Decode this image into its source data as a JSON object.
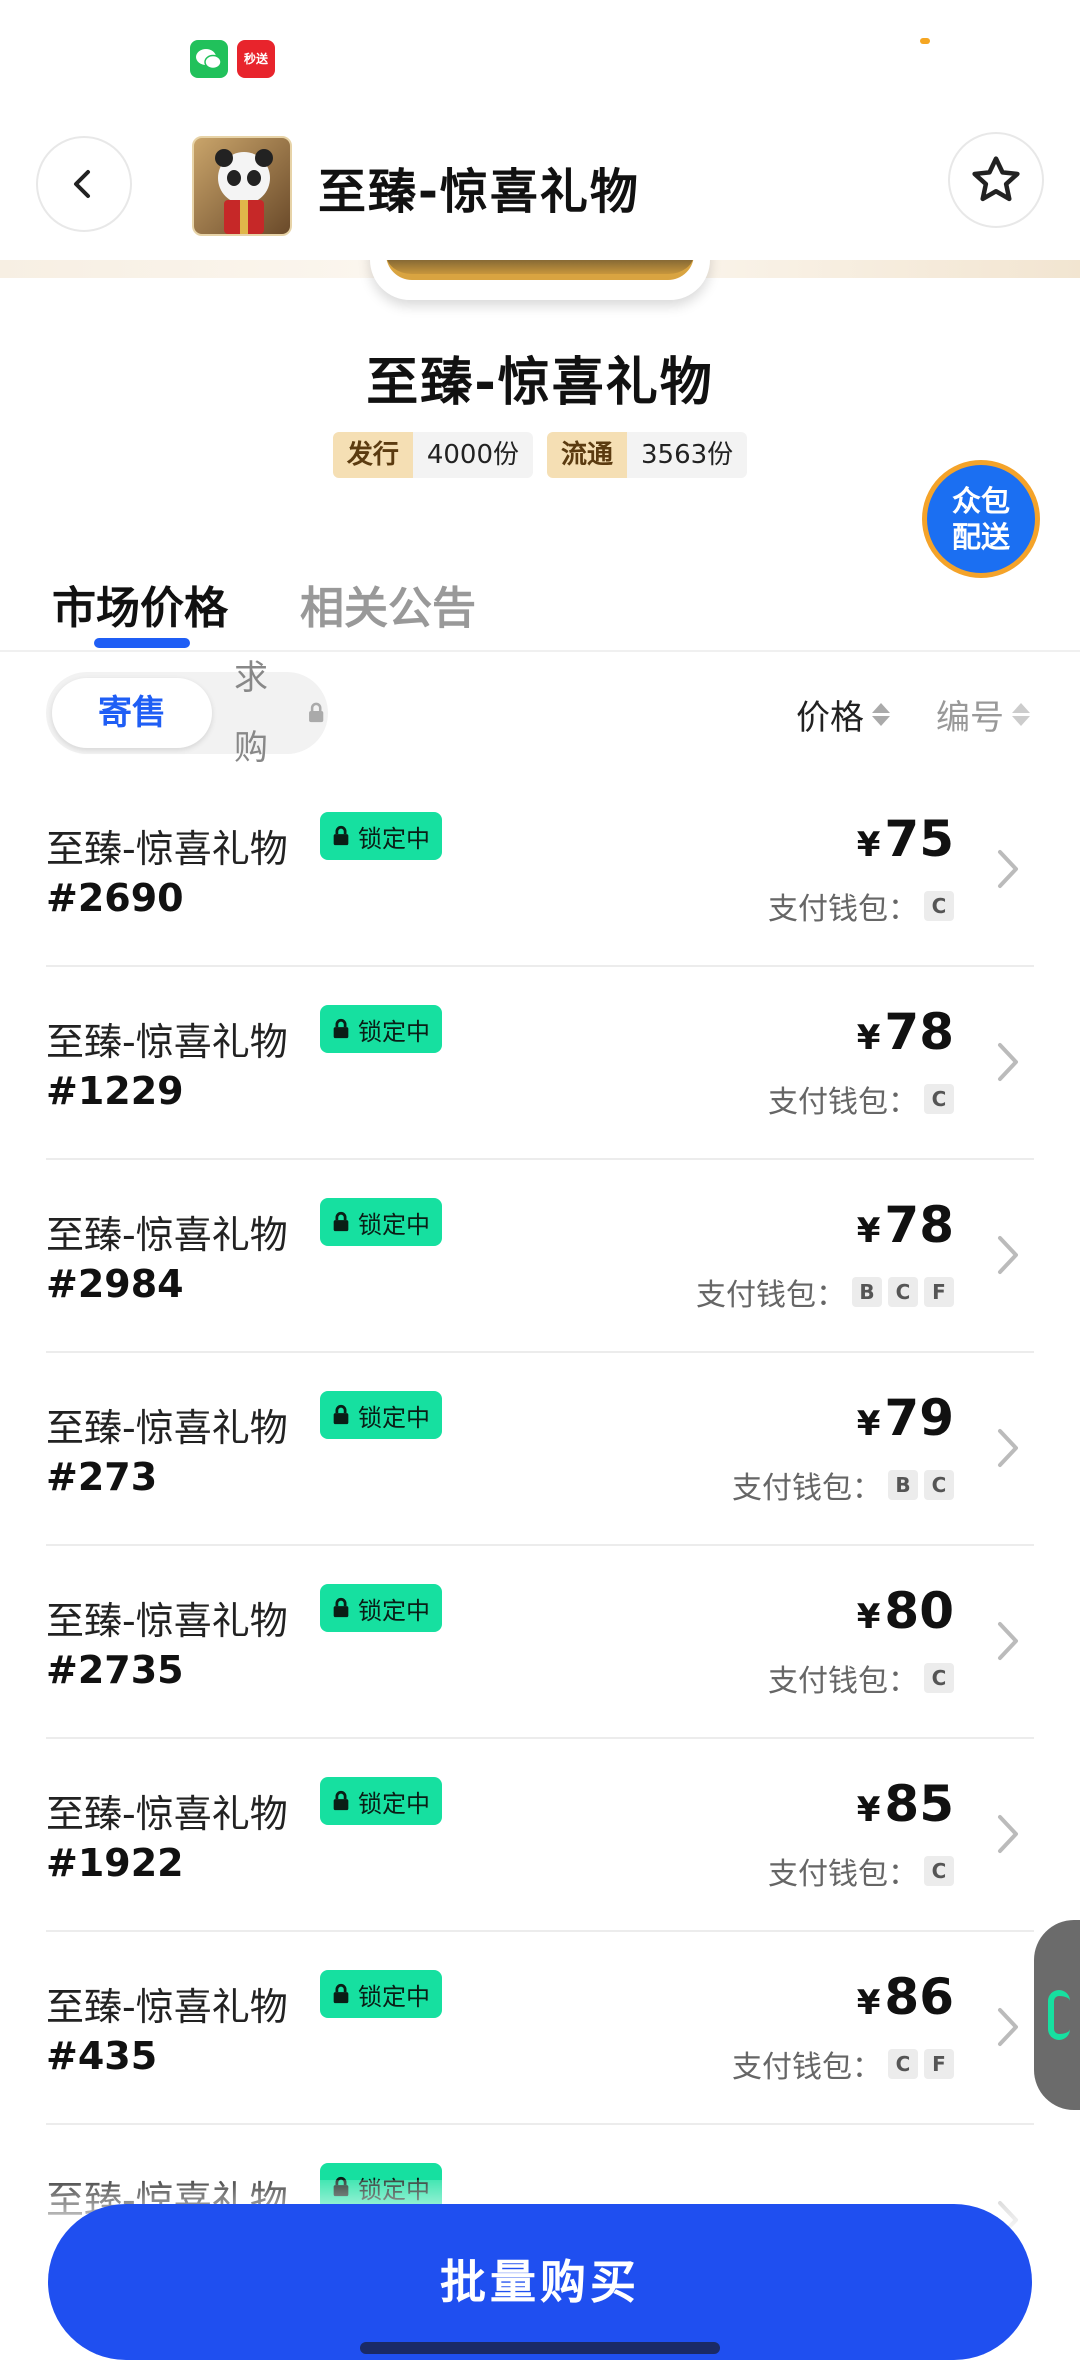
{
  "status_bar": {
    "wechat_icon": "wechat-icon",
    "miaosong_label": "秒送"
  },
  "header": {
    "title": "至臻-惊喜礼物",
    "back_icon": "chevron-left-icon",
    "favorite_icon": "star-outline-icon"
  },
  "item": {
    "title": "至臻-惊喜礼物",
    "issue_label": "发行",
    "issue_value": "4000份",
    "circulation_label": "流通",
    "circulation_value": "3563份"
  },
  "floating_badge": {
    "line1": "众包",
    "line2": "配送"
  },
  "tabs": [
    {
      "label": "市场价格",
      "active": true
    },
    {
      "label": "相关公告",
      "active": false
    }
  ],
  "filters": {
    "consign_label": "寄售",
    "request_label": "求购",
    "sort_price": "价格",
    "sort_number": "编号"
  },
  "listings": [
    {
      "name": "至臻-惊喜礼物",
      "number": "#2690",
      "status": "锁定中",
      "price": "75",
      "wallet_label": "支付钱包：",
      "wallets": [
        "C"
      ]
    },
    {
      "name": "至臻-惊喜礼物",
      "number": "#1229",
      "status": "锁定中",
      "price": "78",
      "wallet_label": "支付钱包：",
      "wallets": [
        "C"
      ]
    },
    {
      "name": "至臻-惊喜礼物",
      "number": "#2984",
      "status": "锁定中",
      "price": "78",
      "wallet_label": "支付钱包：",
      "wallets": [
        "B",
        "C",
        "F"
      ]
    },
    {
      "name": "至臻-惊喜礼物",
      "number": "#273",
      "status": "锁定中",
      "price": "79",
      "wallet_label": "支付钱包：",
      "wallets": [
        "B",
        "C"
      ]
    },
    {
      "name": "至臻-惊喜礼物",
      "number": "#2735",
      "status": "锁定中",
      "price": "80",
      "wallet_label": "支付钱包：",
      "wallets": [
        "C"
      ]
    },
    {
      "name": "至臻-惊喜礼物",
      "number": "#1922",
      "status": "锁定中",
      "price": "85",
      "wallet_label": "支付钱包：",
      "wallets": [
        "C"
      ]
    },
    {
      "name": "至臻-惊喜礼物",
      "number": "#435",
      "status": "锁定中",
      "price": "86",
      "wallet_label": "支付钱包：",
      "wallets": [
        "C",
        "F"
      ]
    },
    {
      "name": "至臻-惊喜礼物",
      "number": "",
      "status": "锁定中",
      "price": "",
      "wallet_label": "",
      "wallets": []
    }
  ],
  "currency_symbol": "¥",
  "bottom": {
    "bulk_buy_label": "批量购买"
  },
  "colors": {
    "accent_blue": "#1f5ef5",
    "lock_green": "#16e0a0",
    "buy_button": "#1f4ff0"
  }
}
